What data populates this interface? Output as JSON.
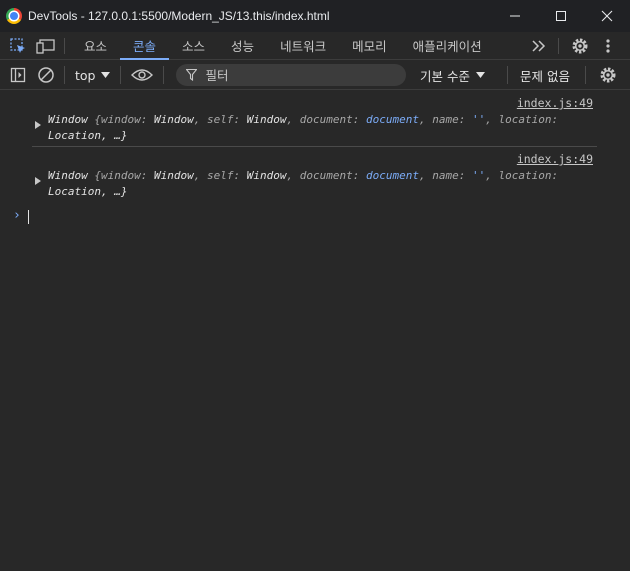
{
  "window": {
    "title": "DevTools - 127.0.0.1:5500/Modern_JS/13.this/index.html"
  },
  "tabs": [
    {
      "label": "요소"
    },
    {
      "label": "콘솔",
      "active": true
    },
    {
      "label": "소스"
    },
    {
      "label": "성능"
    },
    {
      "label": "네트워크"
    },
    {
      "label": "메모리"
    },
    {
      "label": "애플리케이션"
    }
  ],
  "toolbar": {
    "context": "top",
    "filter_placeholder": "필터",
    "levels": "기본 수준",
    "issues": "문제 없음"
  },
  "messages": [
    {
      "source": "index.js:49",
      "object_name": "Window",
      "line1_props": [
        {
          "key": "window",
          "value": "Window"
        },
        {
          "key": "self",
          "value": "Window"
        },
        {
          "key": "document",
          "value": "document"
        },
        {
          "key": "name",
          "value": "''"
        },
        {
          "key": "location",
          "value": ""
        }
      ],
      "line2": "Location, …}"
    },
    {
      "source": "index.js:49",
      "object_name": "Window",
      "line1_props": [
        {
          "key": "window",
          "value": "Window"
        },
        {
          "key": "self",
          "value": "Window"
        },
        {
          "key": "document",
          "value": "document"
        },
        {
          "key": "name",
          "value": "''"
        },
        {
          "key": "location",
          "value": ""
        }
      ],
      "line2": "Location, …}"
    }
  ],
  "prompt_symbol": "›",
  "colors": {
    "accent": "#7cacf8",
    "background": "#282828",
    "titlebar": "#202124"
  }
}
